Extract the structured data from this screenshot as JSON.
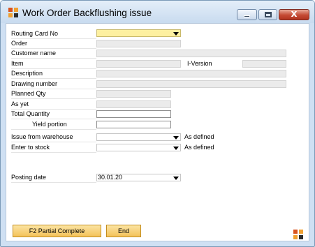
{
  "window": {
    "title": "Work Order Backflushing issue"
  },
  "labels": {
    "routing_card_no": "Routing Card No",
    "order": "Order",
    "customer_name": "Customer name",
    "item": "Item",
    "i_version": "I-Version",
    "description": "Description",
    "drawing_number": "Drawing number",
    "planned_qty": "Planned Qty",
    "as_yet": "As yet",
    "total_quantity": "Total Quantity",
    "yield_portion": "Yield portion",
    "issue_from_warehouse": "Issue from warehouse",
    "enter_to_stock": "Enter to stock",
    "posting_date": "Posting date"
  },
  "hints": {
    "issue_as_defined": "As defined",
    "enter_as_defined": "As defined"
  },
  "fields": {
    "routing_card_no": "",
    "issue_from_warehouse": "",
    "enter_to_stock": "",
    "posting_date": "30.01.20"
  },
  "buttons": {
    "f2_partial_complete": "F2 Partial Complete",
    "end": "End"
  },
  "icons": {
    "app": "app-logo-icon",
    "corner": "app-logo-icon"
  },
  "colors": {
    "required_field": "#fdf0a0",
    "button": "#f4c25a",
    "close_button": "#c44a34"
  }
}
